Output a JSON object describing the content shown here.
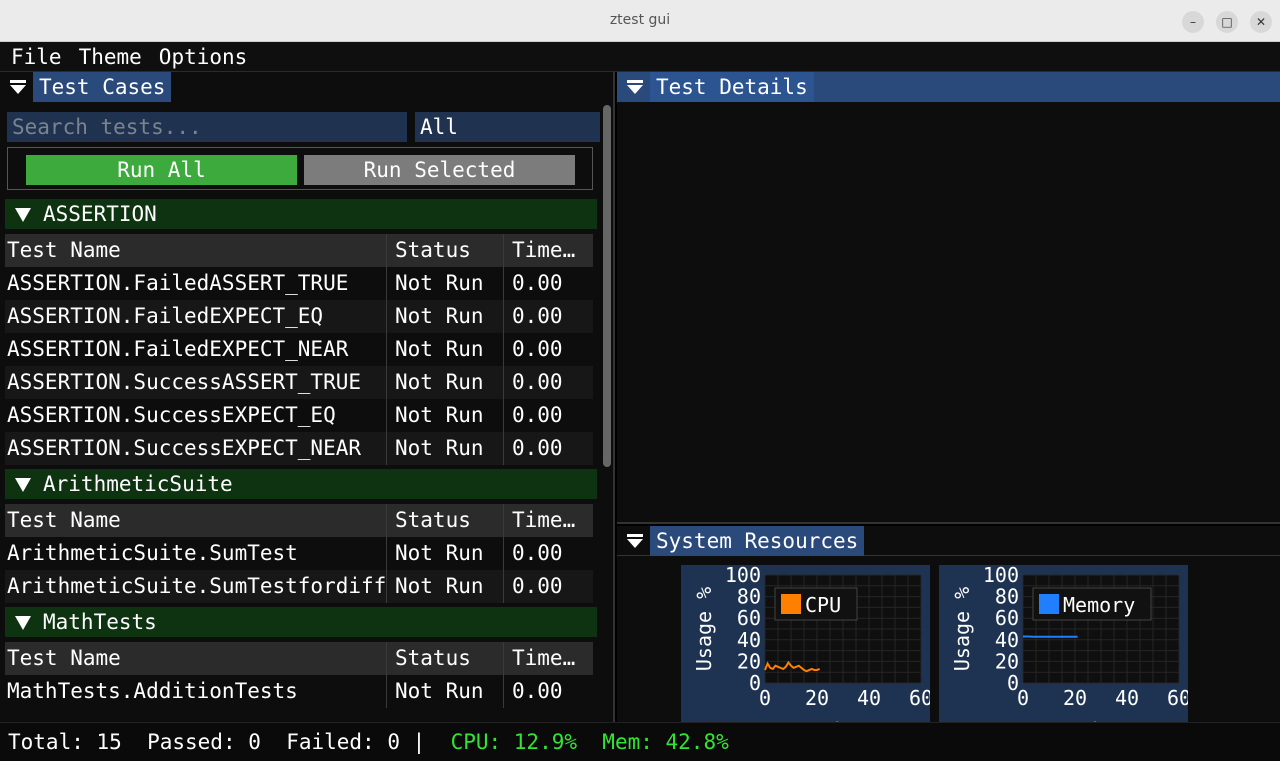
{
  "window": {
    "title": "ztest gui"
  },
  "menu": {
    "file": "File",
    "theme": "Theme",
    "options": "Options"
  },
  "left_panel": {
    "title": "Test Cases",
    "search_placeholder": "Search tests...",
    "filter_value": "All",
    "run_all": "Run All",
    "run_selected": "Run Selected",
    "columns": [
      "Test Name",
      "Status",
      "Time…"
    ],
    "suites": [
      {
        "name": "ASSERTION",
        "tests": [
          {
            "name": "ASSERTION.FailedASSERT_TRUE",
            "status": "Not Run",
            "time": "0.00"
          },
          {
            "name": "ASSERTION.FailedEXPECT_EQ",
            "status": "Not Run",
            "time": "0.00"
          },
          {
            "name": "ASSERTION.FailedEXPECT_NEAR",
            "status": "Not Run",
            "time": "0.00"
          },
          {
            "name": "ASSERTION.SuccessASSERT_TRUE",
            "status": "Not Run",
            "time": "0.00"
          },
          {
            "name": "ASSERTION.SuccessEXPECT_EQ",
            "status": "Not Run",
            "time": "0.00"
          },
          {
            "name": "ASSERTION.SuccessEXPECT_NEAR",
            "status": "Not Run",
            "time": "0.00"
          }
        ]
      },
      {
        "name": "ArithmeticSuite",
        "tests": [
          {
            "name": "ArithmeticSuite.SumTest",
            "status": "Not Run",
            "time": "0.00"
          },
          {
            "name": "ArithmeticSuite.SumTestfordifferent",
            "status": "Not Run",
            "time": "0.00"
          }
        ]
      },
      {
        "name": "MathTests",
        "tests": [
          {
            "name": "MathTests.AdditionTests",
            "status": "Not Run",
            "time": "0.00"
          }
        ]
      }
    ]
  },
  "details_panel": {
    "title": "Test Details"
  },
  "resources_panel": {
    "title": "System Resources"
  },
  "chart_data": [
    {
      "type": "line",
      "ylabel": "Usage %",
      "xlabel": "Time",
      "xlim": [
        0,
        60
      ],
      "ylim": [
        0,
        100
      ],
      "xticks": [
        "0",
        "20",
        "40",
        "60"
      ],
      "yticks": [
        "100",
        "80",
        "60",
        "40",
        "20",
        "0"
      ],
      "grid": true,
      "legend": "top-left",
      "series": [
        {
          "name": "CPU",
          "color": "#ff8000",
          "x": [
            0,
            1,
            2,
            3,
            4,
            5,
            6,
            7,
            8,
            9,
            10,
            11,
            12,
            13,
            14,
            15,
            16,
            17,
            18,
            19,
            20,
            21
          ],
          "y": [
            12,
            18,
            14,
            13,
            16,
            15,
            14,
            13,
            15,
            19,
            16,
            14,
            15,
            16,
            14,
            12,
            11,
            12,
            13,
            12,
            12,
            13
          ]
        }
      ]
    },
    {
      "type": "line",
      "ylabel": "Usage %",
      "xlabel": "Time",
      "xlim": [
        0,
        60
      ],
      "ylim": [
        0,
        100
      ],
      "xticks": [
        "0",
        "20",
        "40",
        "60"
      ],
      "yticks": [
        "100",
        "80",
        "60",
        "40",
        "20",
        "0"
      ],
      "grid": true,
      "legend": "top-left",
      "series": [
        {
          "name": "Memory",
          "color": "#1f7fff",
          "x": [
            0,
            2,
            4,
            6,
            8,
            10,
            12,
            14,
            16,
            18,
            20,
            21
          ],
          "y": [
            43,
            43,
            42.8,
            42.8,
            42.8,
            42.8,
            42.8,
            42.8,
            42.8,
            42.8,
            42.8,
            42.8
          ]
        }
      ]
    }
  ],
  "status": {
    "total": "Total: 15",
    "passed": "Passed: 0",
    "failed": "Failed: 0 |",
    "cpu": "CPU: 12.9%",
    "mem": "Mem: 42.8%"
  },
  "colors": {
    "accent": "#294a7a",
    "suite_bg": "#0e3310",
    "run_all": "#3daa3d",
    "run_selected": "#7c7c7c",
    "status_green": "#33e533"
  }
}
